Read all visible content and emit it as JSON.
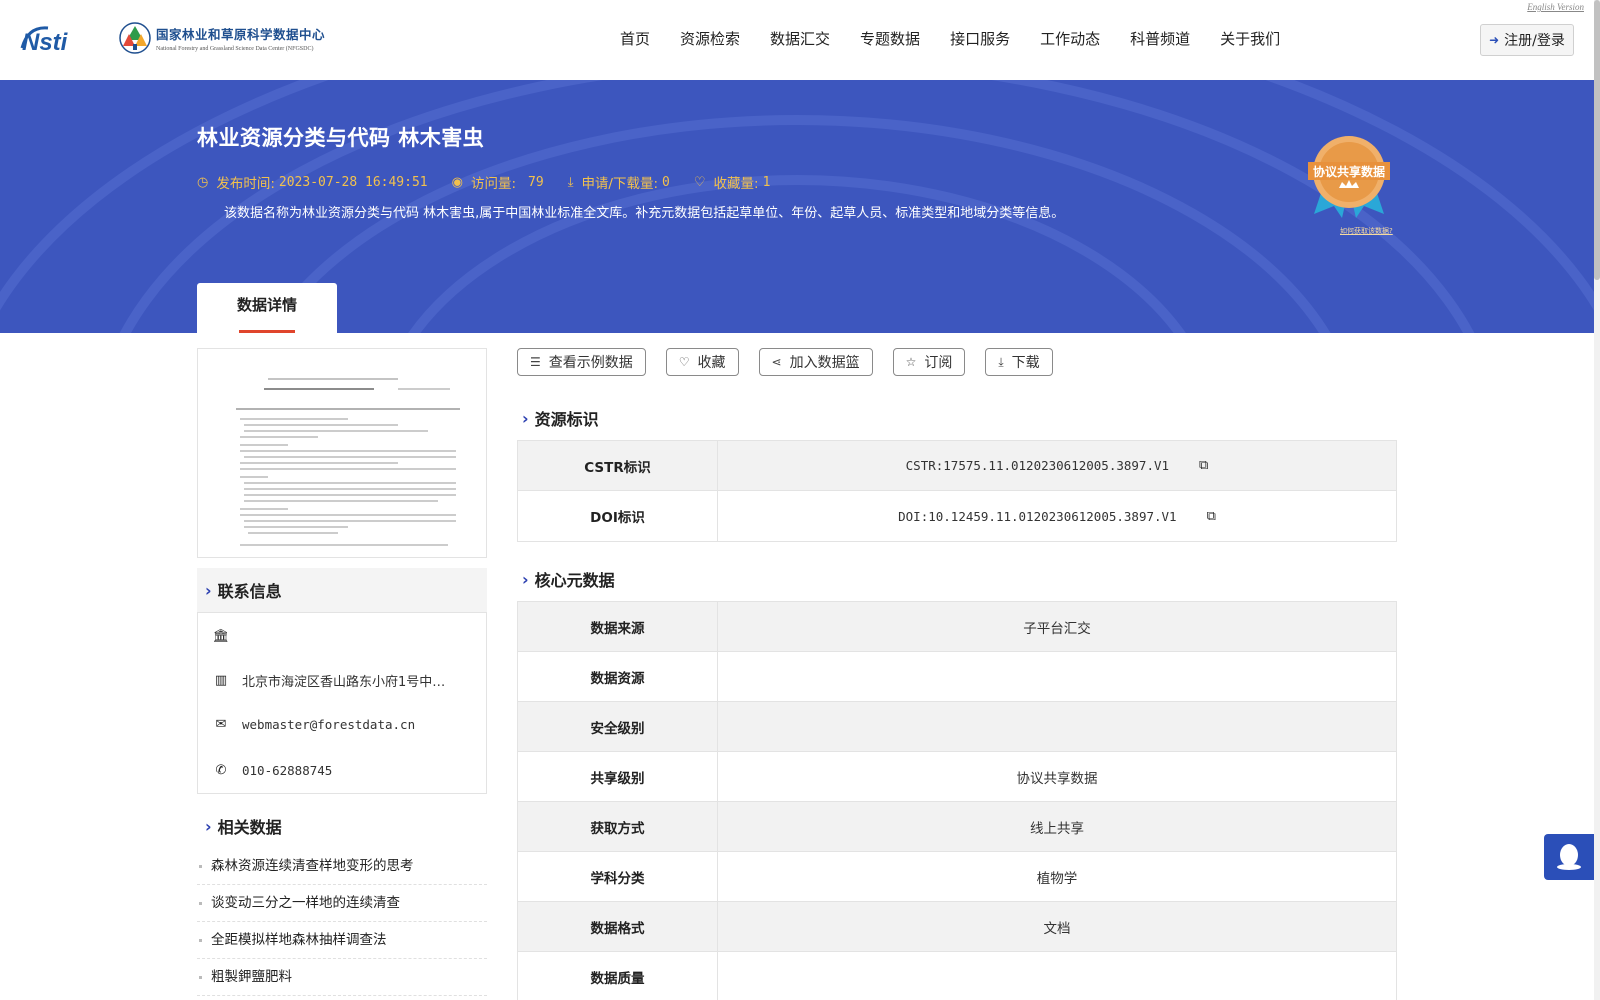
{
  "header": {
    "logo_nsti": "Nsti",
    "logo_cn": "国家林业和草原科学数据中心",
    "logo_en": "National Forestry and Grassland Science Data Center (NFGSDC)",
    "english_link": "English Version",
    "login_label": "注册/登录",
    "nav": [
      "首页",
      "资源检索",
      "数据汇交",
      "专题数据",
      "接口服务",
      "工作动态",
      "科普频道",
      "关于我们"
    ]
  },
  "banner": {
    "title": "林业资源分类与代码 林木害虫",
    "publish_label": "发布时间:",
    "publish_value": "2023-07-28 16:49:51",
    "visits_label": "访问量:",
    "visits_value": "79",
    "downloads_label": "申请/下载量:",
    "downloads_value": "0",
    "favorites_label": "收藏量:",
    "favorites_value": "1",
    "description": "该数据名称为林业资源分类与代码 林木害虫,属于中国林业标准全文库。补充元数据包括起草单位、年份、起草人员、标准类型和地域分类等信息。",
    "badge_label": "协议共享数据",
    "badge_link": "如何获取该数据?",
    "tab_label": "数据详情"
  },
  "actions": [
    "查看示例数据",
    "收藏",
    "加入数据篮",
    "订阅",
    "下载"
  ],
  "sections": {
    "resource_id": "资源标识",
    "core_meta": "核心元数据",
    "contact": "联系信息",
    "related": "相关数据"
  },
  "identifiers": [
    {
      "key": "CSTR标识",
      "value": "CSTR:17575.11.0120230612005.3897.V1"
    },
    {
      "key": "DOI标识",
      "value": "DOI:10.12459.11.0120230612005.3897.V1"
    }
  ],
  "core_metadata": [
    {
      "key": "数据来源",
      "value": "子平台汇交"
    },
    {
      "key": "数据资源",
      "value": ""
    },
    {
      "key": "安全级别",
      "value": ""
    },
    {
      "key": "共享级别",
      "value": "协议共享数据"
    },
    {
      "key": "获取方式",
      "value": "线上共享"
    },
    {
      "key": "学科分类",
      "value": "植物学"
    },
    {
      "key": "数据格式",
      "value": "文档"
    },
    {
      "key": "数据质量",
      "value": ""
    }
  ],
  "contact": {
    "address": "北京市海淀区香山路东小府1号中…",
    "email": "webmaster@forestdata.cn",
    "phone": "010-62888745"
  },
  "related": [
    "森林资源连续清查样地变形的思考",
    "谈变动三分之一样地的连续清查",
    "全距模拟样地森林抽样调查法",
    "粗製鉀鹽肥料"
  ],
  "colors": {
    "banner": "#3d56be",
    "accent": "#2b3fb0",
    "meta": "#f2c14e",
    "tab_underline": "#e0452c"
  }
}
